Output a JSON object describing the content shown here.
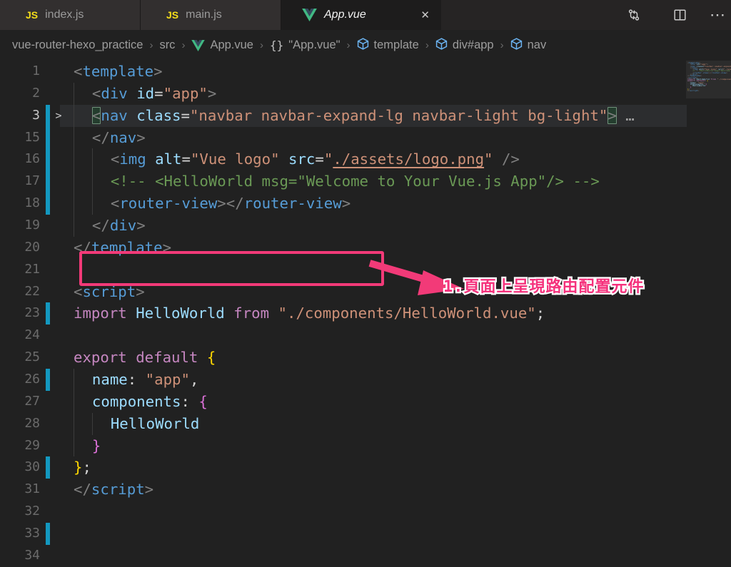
{
  "tabbar": {
    "tabs": [
      {
        "label": "index.js",
        "icon": "js-icon",
        "active": false
      },
      {
        "label": "main.js",
        "icon": "js-icon",
        "active": false
      },
      {
        "label": "App.vue",
        "icon": "vue-icon",
        "active": true,
        "close_glyph": "✕"
      }
    ],
    "js_badge": "JS",
    "actions": [
      {
        "name": "open-changes-icon"
      },
      {
        "name": "split-editor-icon"
      },
      {
        "name": "more-actions-icon",
        "glyph": "⋯"
      }
    ]
  },
  "breadcrumb": {
    "separator": "›",
    "items": [
      {
        "label": "vue-router-hexo_practice",
        "icon": null
      },
      {
        "label": "src",
        "icon": null
      },
      {
        "label": "App.vue",
        "icon": "vue-icon"
      },
      {
        "label": "\"App.vue\"",
        "icon": "braces-icon"
      },
      {
        "label": "template",
        "icon": "symbol-cube-icon"
      },
      {
        "label": "div#app",
        "icon": "symbol-cube-icon"
      },
      {
        "label": "nav",
        "icon": "symbol-cube-icon"
      }
    ]
  },
  "code": {
    "fold_chevron": ">",
    "lines": [
      {
        "n": 1,
        "tokens": [
          [
            "<",
            "pu"
          ],
          [
            "template",
            "tag"
          ],
          [
            ">",
            "pu"
          ]
        ]
      },
      {
        "n": 2,
        "ind": 2,
        "tokens": [
          [
            "<",
            "pu"
          ],
          [
            "div",
            "tag"
          ],
          [
            " ",
            "pl"
          ],
          [
            "id",
            "at"
          ],
          [
            "=",
            "pl"
          ],
          [
            "\"app\"",
            "st"
          ],
          [
            ">",
            "pu"
          ]
        ]
      },
      {
        "n": 3,
        "ind": 2,
        "bar": true,
        "fold": true,
        "hl": true,
        "active": true,
        "tokens": [
          [
            "<",
            "pu",
            "bx"
          ],
          [
            "nav",
            "tag"
          ],
          [
            " ",
            "pl"
          ],
          [
            "class",
            "at"
          ],
          [
            "=",
            "pl"
          ],
          [
            "\"navbar navbar-expand-lg navbar-light bg-light\"",
            "st"
          ],
          [
            ">",
            "pu",
            "bx"
          ],
          [
            " …",
            "fd"
          ]
        ]
      },
      {
        "n": 15,
        "ind": 2,
        "bar": true,
        "tokens": [
          [
            "</",
            "pu"
          ],
          [
            "nav",
            "tag"
          ],
          [
            ">",
            "pu"
          ]
        ]
      },
      {
        "n": 16,
        "ind": 4,
        "bar": true,
        "tokens": [
          [
            "<",
            "pu"
          ],
          [
            "img",
            "tag"
          ],
          [
            " ",
            "pl"
          ],
          [
            "alt",
            "at"
          ],
          [
            "=",
            "pl"
          ],
          [
            "\"Vue logo\"",
            "st"
          ],
          [
            " ",
            "pl"
          ],
          [
            "src",
            "at"
          ],
          [
            "=",
            "pl"
          ],
          [
            "\"",
            "st"
          ],
          [
            "./assets/logo.png",
            "st",
            "ul"
          ],
          [
            "\"",
            "st"
          ],
          [
            " />",
            "pu"
          ]
        ]
      },
      {
        "n": 17,
        "ind": 4,
        "bar": true,
        "tokens": [
          [
            "<!-- <HelloWorld msg=\"Welcome to Your Vue.js App\"/> -->",
            "cm"
          ]
        ]
      },
      {
        "n": 18,
        "ind": 4,
        "bar": true,
        "tokens": [
          [
            "<",
            "pu"
          ],
          [
            "router-view",
            "tag"
          ],
          [
            "></",
            "pu"
          ],
          [
            "router-view",
            "tag"
          ],
          [
            ">",
            "pu"
          ]
        ]
      },
      {
        "n": 19,
        "ind": 2,
        "tokens": [
          [
            "</",
            "pu"
          ],
          [
            "div",
            "tag"
          ],
          [
            ">",
            "pu"
          ]
        ]
      },
      {
        "n": 20,
        "tokens": [
          [
            "</",
            "pu"
          ],
          [
            "template",
            "tag"
          ],
          [
            ">",
            "pu"
          ]
        ]
      },
      {
        "n": 21,
        "tokens": []
      },
      {
        "n": 22,
        "tokens": [
          [
            "<",
            "pu"
          ],
          [
            "script",
            "tag"
          ],
          [
            ">",
            "pu"
          ]
        ]
      },
      {
        "n": 23,
        "bar": true,
        "tokens": [
          [
            "import",
            "kw"
          ],
          [
            " ",
            "pl"
          ],
          [
            "HelloWorld",
            "id"
          ],
          [
            " ",
            "pl"
          ],
          [
            "from",
            "kw"
          ],
          [
            " ",
            "pl"
          ],
          [
            "\"./components/HelloWorld.vue\"",
            "st"
          ],
          [
            ";",
            "pl"
          ]
        ]
      },
      {
        "n": 24,
        "tokens": []
      },
      {
        "n": 25,
        "tokens": [
          [
            "export",
            "kw"
          ],
          [
            " ",
            "pl"
          ],
          [
            "default",
            "kw"
          ],
          [
            " ",
            "pl"
          ],
          [
            "{",
            "b1"
          ]
        ]
      },
      {
        "n": 26,
        "ind": 2,
        "bar": true,
        "tokens": [
          [
            "name",
            "at"
          ],
          [
            ": ",
            "pl"
          ],
          [
            "\"app\"",
            "st"
          ],
          [
            ",",
            "pl"
          ]
        ]
      },
      {
        "n": 27,
        "ind": 2,
        "tokens": [
          [
            "components",
            "at"
          ],
          [
            ": ",
            "pl"
          ],
          [
            "{",
            "b2"
          ]
        ]
      },
      {
        "n": 28,
        "ind": 4,
        "tokens": [
          [
            "HelloWorld",
            "id"
          ]
        ]
      },
      {
        "n": 29,
        "ind": 2,
        "tokens": [
          [
            "}",
            "b2"
          ]
        ]
      },
      {
        "n": 30,
        "bar": true,
        "tokens": [
          [
            "}",
            "b1"
          ],
          [
            ";",
            "pl"
          ]
        ]
      },
      {
        "n": 31,
        "tokens": [
          [
            "</",
            "pu"
          ],
          [
            "script",
            "tag"
          ],
          [
            ">",
            "pu"
          ]
        ]
      },
      {
        "n": 32,
        "tokens": []
      },
      {
        "n": 33,
        "bar": true,
        "tokens": []
      },
      {
        "n": 34,
        "tokens": []
      }
    ]
  },
  "annotation": {
    "label": "1.頁面上呈現路由配置元件",
    "color": "#f23a78"
  },
  "colors": {
    "accent_modified_gutter": "#1398bf",
    "annotation_pink": "#f23a78",
    "editor_bg": "#212121",
    "vue_green": "#41b883",
    "vue_dark": "#35495e",
    "js_yellow": "#f5de19",
    "symbol_blue": "#6cb4f2"
  }
}
